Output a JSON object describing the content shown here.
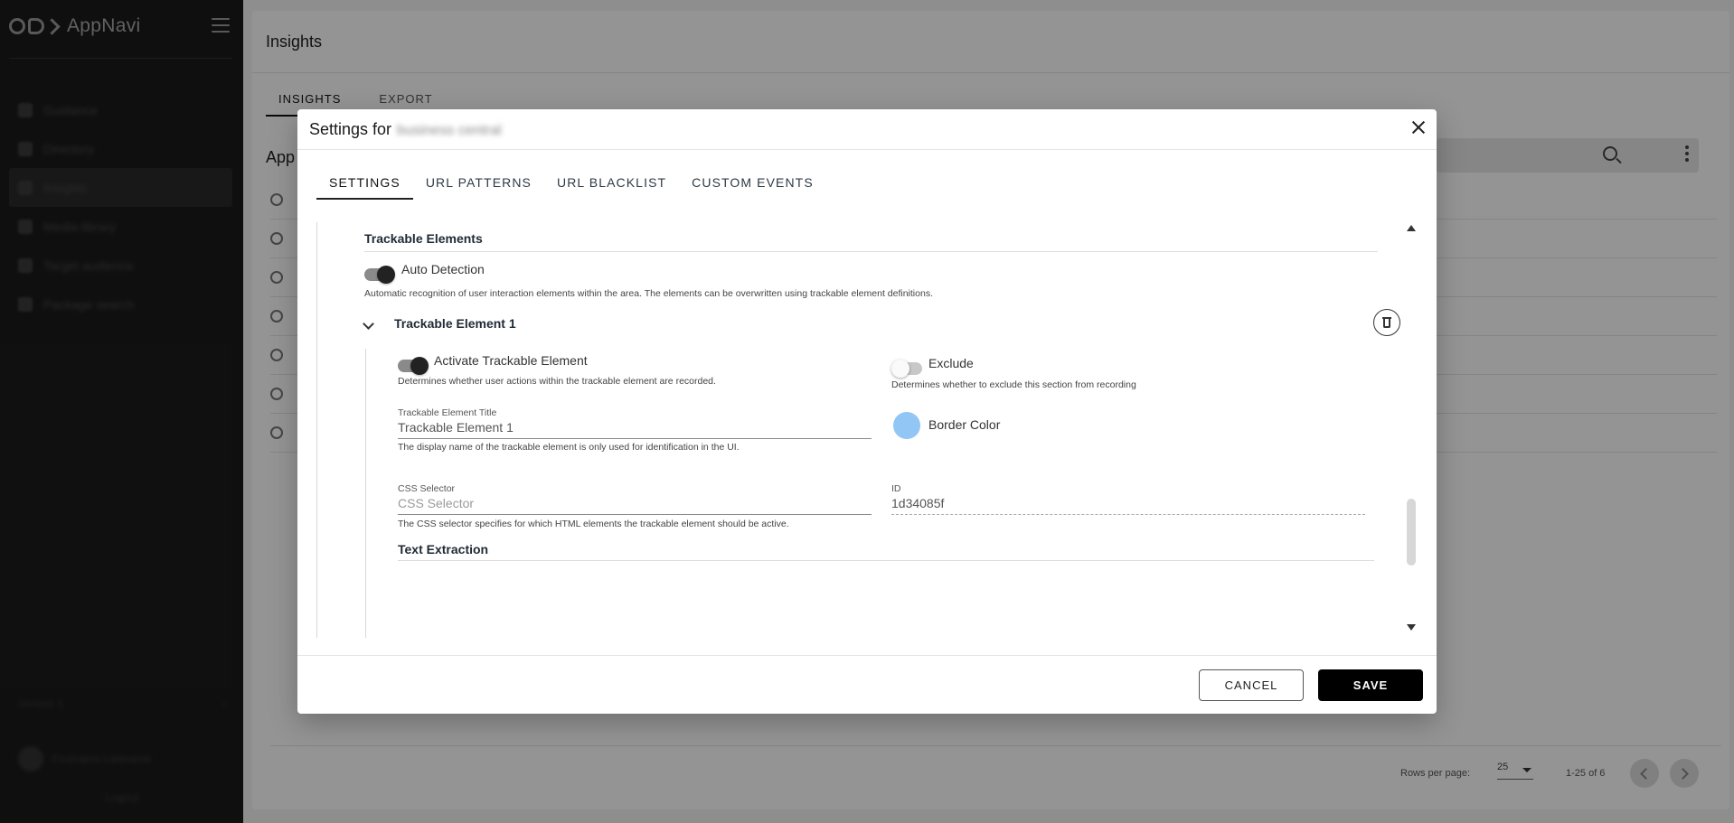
{
  "app": {
    "name": "AppNavi"
  },
  "sidebar": {
    "items": [
      {
        "label": "Guidance",
        "active": false
      },
      {
        "label": "Directory",
        "active": false
      },
      {
        "label": "Insights",
        "active": true
      },
      {
        "label": "Media library",
        "active": false
      },
      {
        "label": "Target audience",
        "active": false
      },
      {
        "label": "Package search",
        "active": false
      }
    ],
    "bottom_label": "Version 1",
    "user_name": "Firstname Lastname",
    "logout_label": "Logout"
  },
  "page": {
    "title": "Insights",
    "tabs": [
      "INSIGHTS",
      "EXPORT"
    ],
    "list_heading": "App",
    "rows_per_page_label": "Rows per page:",
    "rows_per_page": "25",
    "range_text": "1-25 of 6"
  },
  "dialog": {
    "title_prefix": "Settings for",
    "title_target": "business central",
    "tabs": [
      "SETTINGS",
      "URL PATTERNS",
      "URL BLACKLIST",
      "CUSTOM EVENTS"
    ],
    "section_title": "Trackable Elements",
    "auto_detection": {
      "label": "Auto Detection",
      "enabled": true,
      "description": "Automatic recognition of user interaction elements within the area. The elements can be overwritten using trackable element definitions."
    },
    "element": {
      "title": "Trackable Element 1",
      "activate": {
        "label": "Activate Trackable Element",
        "enabled": true,
        "description": "Determines whether user actions within the trackable element are recorded."
      },
      "exclude": {
        "label": "Exclude",
        "enabled": false,
        "description": "Determines whether to exclude this section from recording"
      },
      "title_field": {
        "label": "Trackable Element Title",
        "value": "Trackable Element 1",
        "hint": "The display name of the trackable element is only used for identification in the UI."
      },
      "border_color": {
        "label": "Border Color",
        "color": "#91c6f5"
      },
      "css_selector": {
        "label": "CSS Selector",
        "placeholder": "CSS Selector",
        "hint": "The CSS selector specifies for which HTML elements the trackable element should be active."
      },
      "id_field": {
        "label": "ID",
        "value": "1d34085f"
      },
      "text_extraction_title": "Text Extraction"
    },
    "cancel_label": "CANCEL",
    "save_label": "SAVE"
  }
}
